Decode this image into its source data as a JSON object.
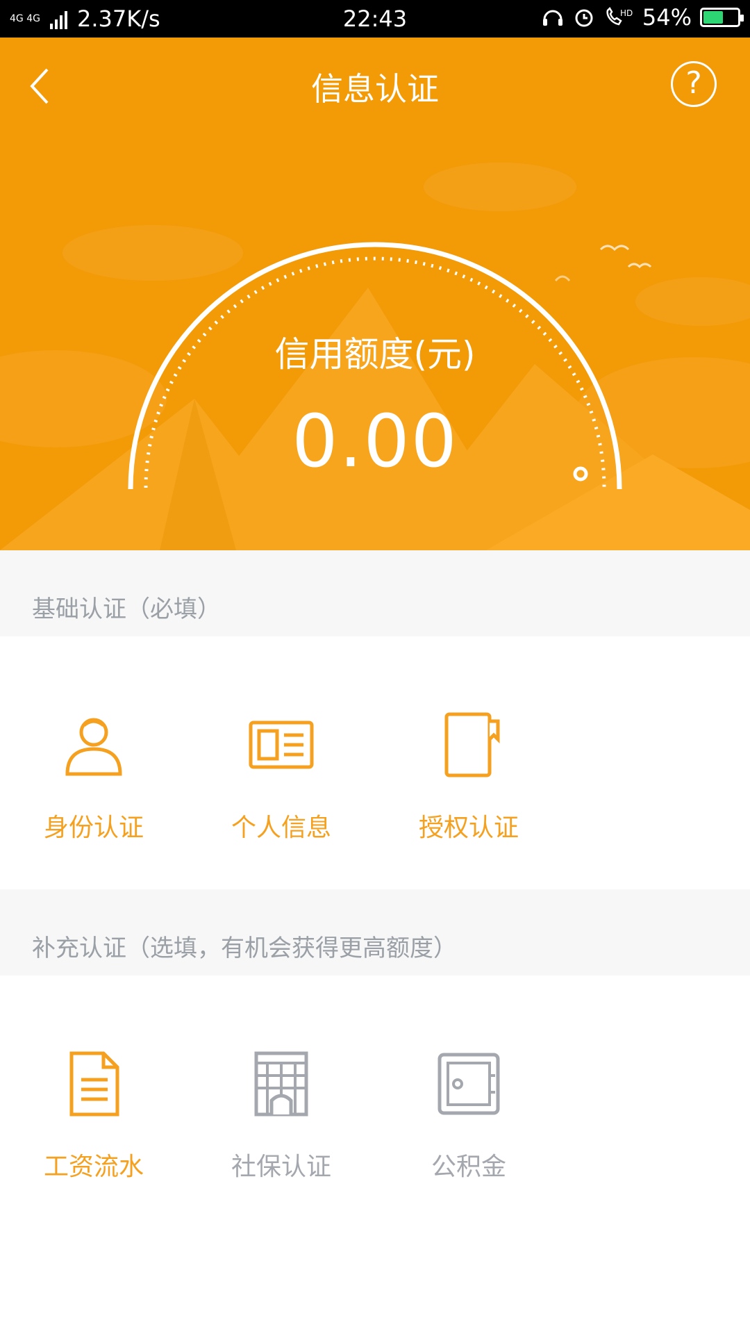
{
  "status_bar": {
    "network": "4G 4G",
    "speed": "2.37K/s",
    "time": "22:43",
    "battery": "54%",
    "icons": [
      "headset-icon",
      "alarm-icon",
      "hd-call-icon",
      "battery-icon"
    ]
  },
  "header": {
    "title": "信息认证",
    "back_icon": "chevron-left-icon",
    "help_icon": "help-icon"
  },
  "credit": {
    "label": "信用额度(元)",
    "value": "0.00"
  },
  "basic_section": {
    "title": "基础认证（必填）",
    "items": [
      {
        "label": "身份认证",
        "icon": "user-icon",
        "color": "#f5a01e"
      },
      {
        "label": "个人信息",
        "icon": "id-card-icon",
        "color": "#f5a01e"
      },
      {
        "label": "授权认证",
        "icon": "notebook-icon",
        "color": "#f5a01e"
      }
    ]
  },
  "extra_section": {
    "title": "补充认证（选填，有机会获得更高额度）",
    "items": [
      {
        "label": "工资流水",
        "icon": "document-icon",
        "color": "#f5a01e"
      },
      {
        "label": "社保认证",
        "icon": "building-icon",
        "color": "#a4a8ae"
      },
      {
        "label": "公积金",
        "icon": "safe-icon",
        "color": "#a4a8ae"
      }
    ]
  },
  "colors": {
    "primary": "#f39a07",
    "accent": "#f5a01e",
    "inactive": "#a4a8ae"
  }
}
